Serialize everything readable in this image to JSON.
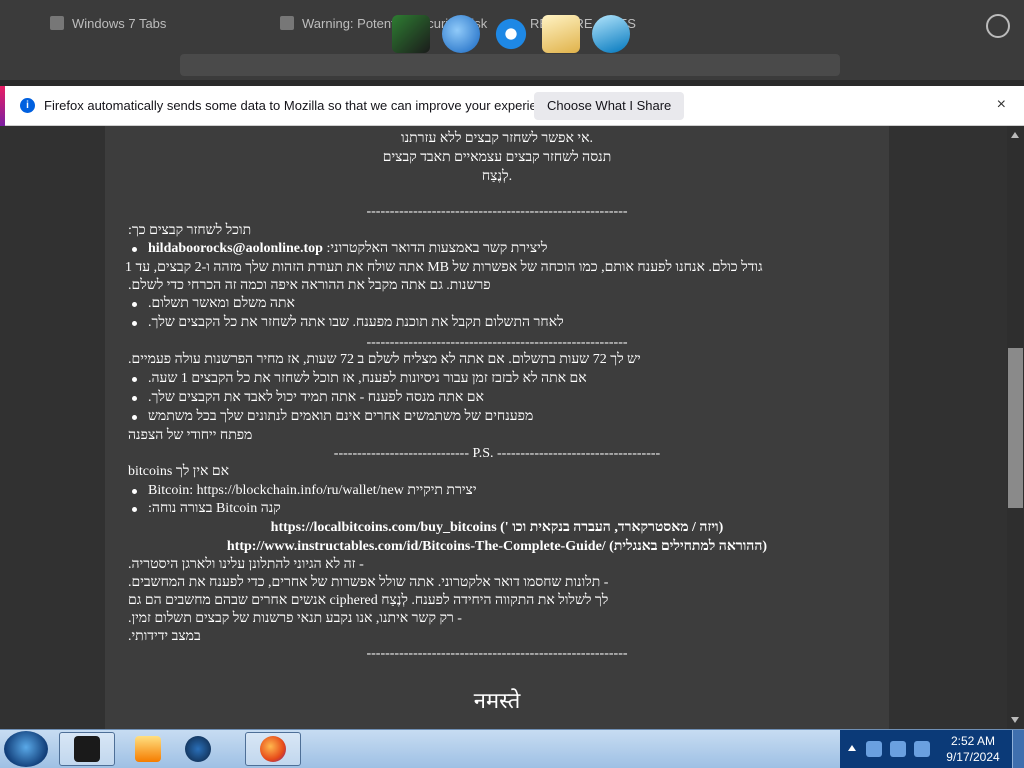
{
  "browser": {
    "tabs": [
      {
        "label": "Windows 7 Tabs"
      },
      {
        "label": "Warning: Potential Security Risk"
      },
      {
        "label": "RESTORE_FILES"
      }
    ]
  },
  "notification": {
    "text": "Firefox automatically sends some data to Mozilla so that we can improve your experience.",
    "button_label": "Choose What I Share",
    "close_icon": "×"
  },
  "page": {
    "line_a1": "אי אפשר לשחזר קבצים ללא עזרתנו.",
    "line_a2": "תנסה לשחזר קבצים עצמאיים תאבד קבצים",
    "line_a3": "לְנֶצַח.",
    "separator_1": "--------------------------------------------------------",
    "restore_heading": "תוכל לשחזר קבצים כך:",
    "email_label": "ליצירת קשר באמצעות הדואר האלקטרוני: ",
    "email": "hildaboorocks@aolonline.top",
    "proof_line1": "גודל כולם. אנחנו לפענח אותם, כמו הוכחה של אפשרות של MB אתה שולח את תעודת הזהות שלך מזהה ו-2 קבצים, עד 1",
    "proof_line2": "פרשנות. גם אתה מקבל את ההוראה איפה וכמה זה הכרחי כדי לשלם.",
    "bullet_pay": "אתה משלם ומאשר תשלום.",
    "bullet_decrypt": "לאחר התשלום תקבל את תוכנת מפענח. שבו אתה לשחזר את כל הקבצים שלך.",
    "separator_2": "--------------------------------------------------------",
    "hours_line": "יש לך 72 שעות בתשלום. אם אתה לא מצליח לשלם ב 72 שעות, אז מחיר הפרשנות עולה פעמיים.",
    "bullet_time": "אם אתה לא לבזבז זמן עבור ניסיונות לפענח, אז תוכל לשחזר את כל הקבצים 1 שעה.",
    "bullet_try": "אם אתה מנסה לפענח - אתה תמיד יכול לאבד את הקבצים שלך.",
    "bullet_others": "מפענחים של משתמשים אחרים אינם תואמים לנתונים שלך בכל משתמש",
    "unique_key": "מפתח ייחודי של הצפנה",
    "ps_line": "----------------------------- P.S. -----------------------------------",
    "no_bitcoins": "אם אין לך bitcoins",
    "bullet_wallet": "יצירת תיקיית Bitcoin: https://blockchain.info/ru/wallet/new",
    "bullet_buy": "קנה Bitcoin בצורה נוחה:",
    "link_buy": "https://localbitcoins.com/buy_bitcoins (' ויזה / מאסטרקארד, העברה בנקאית וכו)",
    "link_guide": "http://www.instructables.com/id/Bitcoins-The-Complete-Guide/ (ההוראה למתחילים באנגלית)",
    "note_1": "- זה לא הגיוני להתלונן עלינו ולארגן היסטריה.",
    "note_2": "- תלונות שחסמו דואר אלקטרוני. אתה שולל אפשרות של אחרים, כדי לפענח את המחשבים.",
    "note_3": "לך לשלול את התקווה היחידה לפענח. לְנֶצַח ciphered אנשים אחרים שבהם מחשבים הם גם",
    "note_4": "- רק קשר איתנו, אנו נקבע תנאי פרשנות של קבצים תשלום זמין.",
    "note_5": "במצב ידידותי.",
    "separator_3": "--------------------------------------------------------",
    "namaste": "नमस्ते"
  },
  "taskbar": {
    "time": "2:52 AM",
    "date": "9/17/2024"
  }
}
